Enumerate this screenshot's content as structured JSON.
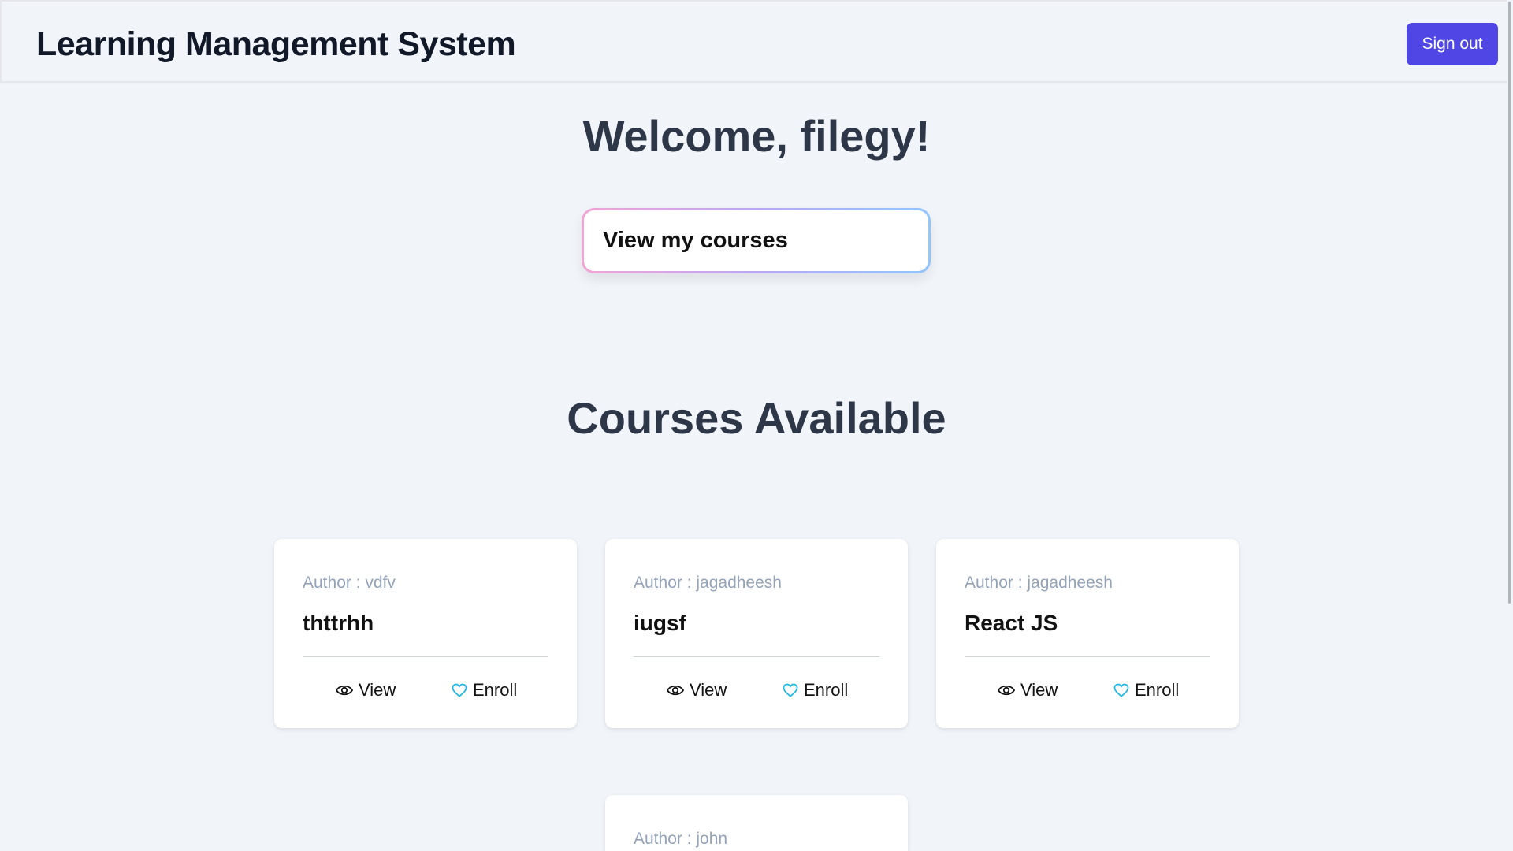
{
  "header": {
    "title": "Learning Management System",
    "signout_label": "Sign out"
  },
  "welcome": "Welcome, filegy!",
  "view_courses_label": "View my courses",
  "section_title": "Courses Available",
  "actions": {
    "view": "View",
    "enroll": "Enroll"
  },
  "courses": [
    {
      "author": "Author : vdfv",
      "name": "thttrhh"
    },
    {
      "author": "Author : jagadheesh",
      "name": "iugsf"
    },
    {
      "author": "Author : jagadheesh",
      "name": "React JS"
    },
    {
      "author": "Author : john",
      "name": ""
    }
  ],
  "colors": {
    "accent": "#4f46e5",
    "heading": "#2d3748",
    "muted": "#94a3b8",
    "heart": "#22b8e6",
    "background": "#f1f4f9"
  },
  "icons": {
    "view": "eye-icon",
    "enroll": "heart-icon"
  }
}
